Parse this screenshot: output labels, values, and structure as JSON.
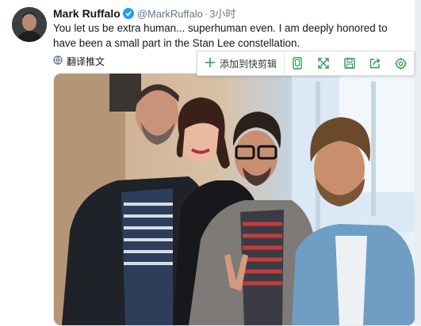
{
  "tweet": {
    "author_name": "Mark Ruffalo",
    "handle": "@MarkRuffalo",
    "separator": "·",
    "time": "3小时",
    "text": "You let us be extra human... superhuman even. I am deeply honored to have been a small part in the Stan Lee constellation.",
    "translate_label": "翻译推文"
  },
  "toolbar": {
    "add_label": "添加到快剪辑",
    "icons": [
      "phone-icon",
      "expand-icon",
      "save-icon",
      "share-icon",
      "settings-icon"
    ]
  },
  "colors": {
    "verified": "#1da1f2",
    "toolbar_accent": "#2e9c4a",
    "muted_text": "#657786"
  }
}
